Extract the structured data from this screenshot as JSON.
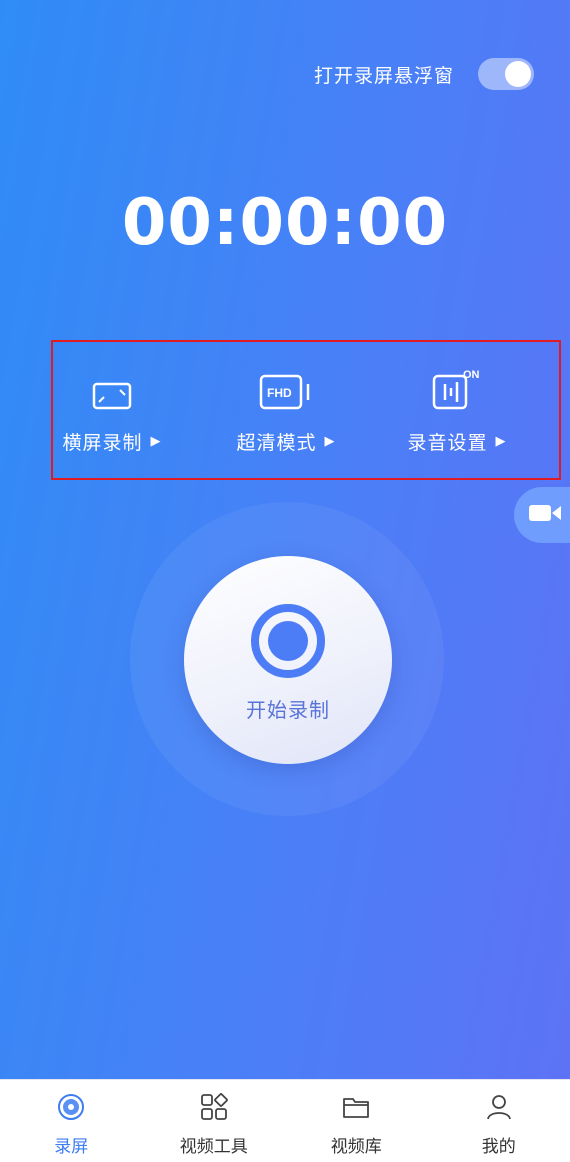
{
  "header": {
    "float_window_label": "打开录屏悬浮窗",
    "float_window_on": true
  },
  "timer": "00:00:00",
  "options": [
    {
      "label": "横屏录制",
      "icon": "landscape-icon"
    },
    {
      "label": "超清模式",
      "icon": "fhd-icon",
      "icon_text": "FHD"
    },
    {
      "label": "录音设置",
      "icon": "audio-on-icon",
      "icon_text": "ON"
    }
  ],
  "record": {
    "label": "开始录制"
  },
  "nav": [
    {
      "label": "录屏",
      "icon": "record-disc-icon",
      "active": true
    },
    {
      "label": "视频工具",
      "icon": "tools-grid-icon",
      "active": false
    },
    {
      "label": "视频库",
      "icon": "folder-icon",
      "active": false
    },
    {
      "label": "我的",
      "icon": "user-icon",
      "active": false
    }
  ],
  "colors": {
    "accent": "#3e7cf1",
    "highlight_box": "#e11b22"
  }
}
